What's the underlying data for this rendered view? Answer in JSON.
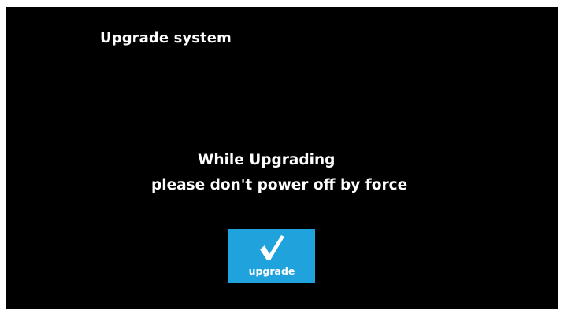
{
  "screen": {
    "title": "Upgrade system",
    "background_color": "#000000"
  },
  "warning": {
    "line1": "While Upgrading",
    "line2": "please don't power off by force"
  },
  "upgrade_button": {
    "label": "upgrade",
    "icon": "checkmark-icon",
    "color": "#20a2dc"
  }
}
